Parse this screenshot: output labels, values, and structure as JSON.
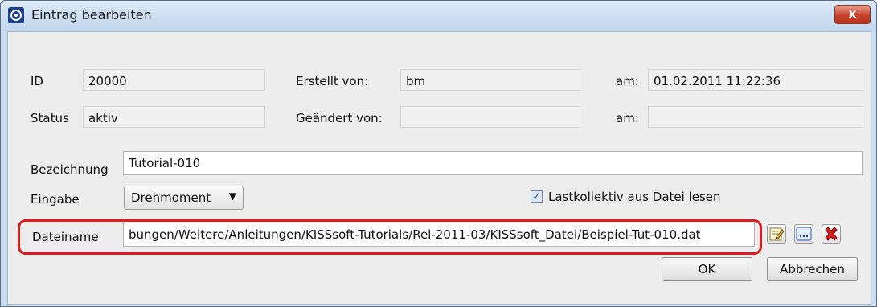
{
  "window": {
    "title": "Eintrag bearbeiten",
    "close_label": "x"
  },
  "row_id": {
    "id_label": "ID",
    "id_value": "20000",
    "created_by_label": "Erstellt von:",
    "created_by_value": "bm",
    "created_at_label": "am:",
    "created_at_value": "01.02.2011  11:22:36"
  },
  "row_status": {
    "status_label": "Status",
    "status_value": "aktiv",
    "changed_by_label": "Geändert von:",
    "changed_by_value": "",
    "changed_at_label": "am:",
    "changed_at_value": ""
  },
  "form": {
    "bezeichnung_label": "Bezeichnung",
    "bezeichnung_value": "Tutorial-010",
    "eingabe_label": "Eingabe",
    "eingabe_selected": "Drehmoment",
    "checkbox_label": "Lastkollektiv aus Datei lesen",
    "checkbox_checked": true,
    "dateiname_label": "Dateiname",
    "dateiname_value": "bungen/Weitere/Anleitungen/KISSsoft-Tutorials/Rel-2011-03/KISSsoft_Datei/Beispiel-Tut-010.dat"
  },
  "file_actions": [
    "edit-file-icon",
    "browse-icon",
    "delete-icon"
  ],
  "buttons": {
    "ok": "OK",
    "cancel": "Abbrechen"
  },
  "colors": {
    "highlight": "#e01b1b",
    "close_button": "#c8432c",
    "titlebar": "#c3d7ee"
  }
}
